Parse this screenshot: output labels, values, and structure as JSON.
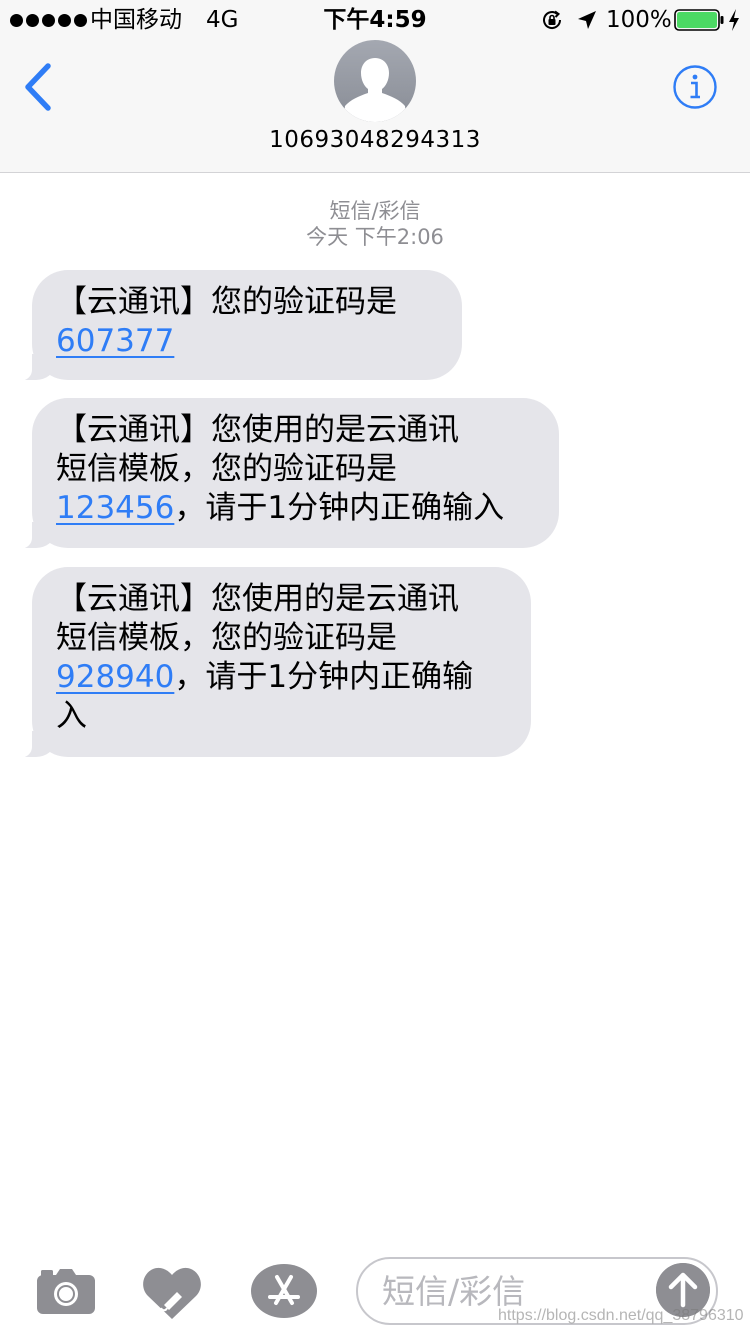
{
  "status_bar": {
    "carrier": "中国移动",
    "network": "4G",
    "time": "下午4:59",
    "battery_percent": "100%",
    "battery_level": 1.0,
    "icons": [
      "signal-dots-icon",
      "orientation-lock-icon",
      "location-arrow-icon",
      "battery-icon",
      "charging-bolt-icon"
    ]
  },
  "nav": {
    "back_icon": "chevron-left-icon",
    "avatar_icon": "person-silhouette-icon",
    "contact": "10693048294313",
    "info_icon": "info-icon"
  },
  "conversation": {
    "message_type": "短信/彩信",
    "timestamp": "今天 下午2:06",
    "messages": [
      {
        "lines": [
          {
            "text": "【云通讯】您的验证码是"
          },
          {
            "code": "607377",
            "rest": ""
          }
        ]
      },
      {
        "lines": [
          {
            "text": "【云通讯】您使用的是云通讯"
          },
          {
            "text": "短信模板，您的验证码是"
          },
          {
            "code": "123456",
            "rest": "，请于1分钟内正确输入"
          }
        ]
      },
      {
        "lines": [
          {
            "text": "【云通讯】您使用的是云通讯"
          },
          {
            "text": "短信模板，您的验证码是"
          },
          {
            "code": "928940",
            "rest": "，请于1分钟内正确输"
          },
          {
            "text": "入"
          }
        ]
      }
    ]
  },
  "compose": {
    "placeholder": "短信/彩信",
    "value": "",
    "icons": [
      "camera-icon",
      "digital-touch-heart-icon",
      "app-store-icon",
      "send-arrow-up-icon"
    ]
  },
  "watermark": "https://blog.csdn.net/qq_38796310",
  "colors": {
    "accent": "#2f7df6",
    "bubble": "#e5e5ea",
    "battery": "#4cd964",
    "meta_text": "#8e8e93"
  }
}
